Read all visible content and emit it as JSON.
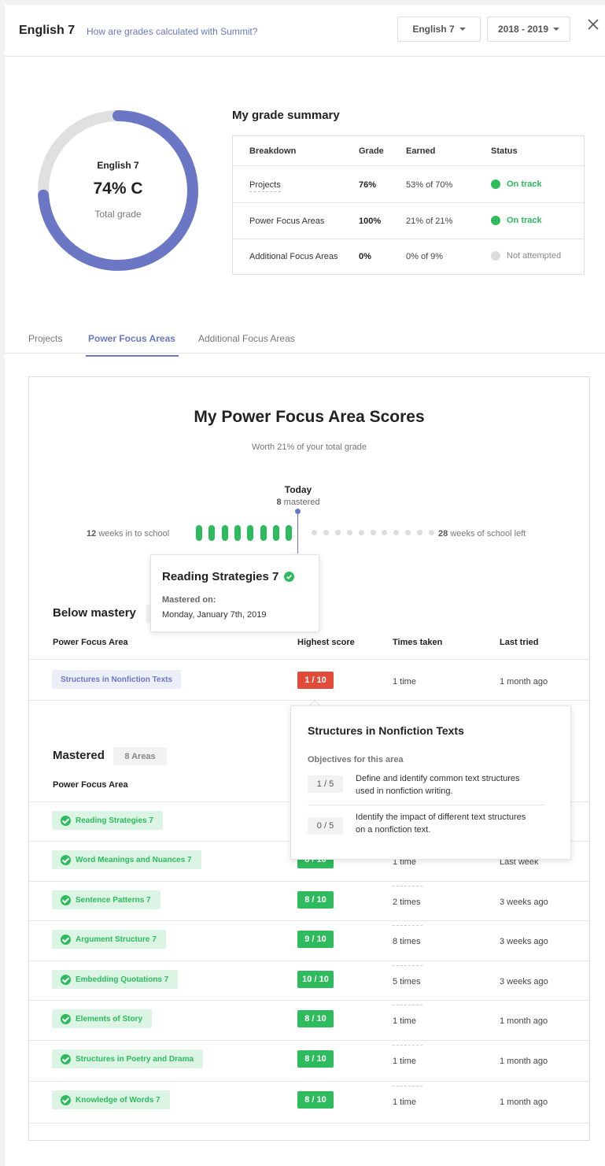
{
  "header": {
    "course_title": "English 7",
    "calc_link": "How are grades calculated with Summit?",
    "course_select": "English 7",
    "year_select": "2018 - 2019"
  },
  "donut": {
    "course": "English 7",
    "grade": "74% C",
    "subtitle": "Total grade",
    "percent": 74,
    "fill_color": "#6b77c4",
    "track_color": "#e0e0e0"
  },
  "summary": {
    "title": "My grade summary",
    "headers": [
      "Breakdown",
      "Grade",
      "Earned",
      "Status"
    ],
    "rows": [
      {
        "breakdown": "Projects",
        "grade": "76%",
        "earned": "53% of 70%",
        "status": "On track",
        "status_color": "#2dbb5d"
      },
      {
        "breakdown": "Power Focus Areas",
        "grade": "100%",
        "earned": "21% of 21%",
        "status": "On track",
        "status_color": "#2dbb5d"
      },
      {
        "breakdown": "Additional Focus Areas",
        "grade": "0%",
        "earned": "0% of 9%",
        "status": "Not attempted",
        "status_color": "#dddddd"
      }
    ]
  },
  "tabs": [
    "Projects",
    "Power Focus Areas",
    "Additional Focus Areas"
  ],
  "active_tab": "Power Focus Areas",
  "scores": {
    "title": "My Power Focus Area Scores",
    "subtitle": "Worth 21% of your total grade",
    "timeline": {
      "today_label": "Today",
      "mastered_count": "8",
      "mastered_word": "mastered",
      "weeks_in": "12",
      "weeks_in_text": "weeks in to school",
      "weeks_left": "28",
      "weeks_left_text": "weeks of school left",
      "mastered_pills": 8,
      "upcoming_dots": 11
    },
    "tooltip_mastered": {
      "title": "Reading Strategies 7",
      "label": "Mastered on:",
      "date": "Monday, January 7th, 2019"
    },
    "below": {
      "title": "Below mastery",
      "headers": [
        "Power Focus Area",
        "Highest score",
        "Times taken",
        "Last tried"
      ],
      "rows": [
        {
          "area": "Structures in Nonfiction Texts",
          "score": "1 / 10",
          "times": "1 time",
          "last": "1 month ago"
        }
      ]
    },
    "tooltip_objectives": {
      "title": "Structures in Nonfiction Texts",
      "subtitle": "Objectives for this area",
      "items": [
        {
          "score": "1 / 5",
          "line1": "Define and identify common text structures",
          "line2": "used in nonfiction writing."
        },
        {
          "score": "0 / 5",
          "line1": "Identify the impact of different text structures",
          "line2": "on a nonfiction text."
        }
      ]
    },
    "mastered": {
      "title": "Mastered",
      "badge": "8 Areas",
      "headers": [
        "Power Focus Area"
      ],
      "rows": [
        {
          "area": "Reading Strategies 7",
          "score": "",
          "times": "",
          "last": ""
        },
        {
          "area": "Word Meanings and Nuances 7",
          "score": "8 / 10",
          "times": "1 time",
          "last": "Last week"
        },
        {
          "area": "Sentence Patterns 7",
          "score": "8 / 10",
          "times": "2 times",
          "last": "3 weeks ago"
        },
        {
          "area": "Argument Structure 7",
          "score": "9 / 10",
          "times": "8 times",
          "last": "3 weeks ago"
        },
        {
          "area": "Embedding Quotations 7",
          "score": "10 / 10",
          "times": "5 times",
          "last": "3 weeks ago"
        },
        {
          "area": "Elements of Story",
          "score": "8 / 10",
          "times": "1 time",
          "last": "1 month ago"
        },
        {
          "area": "Structures in Poetry and Drama",
          "score": "8 / 10",
          "times": "1 time",
          "last": "1 month ago"
        },
        {
          "area": "Knowledge of Words 7",
          "score": "8 / 10",
          "times": "1 time",
          "last": "1 month ago"
        }
      ]
    }
  }
}
